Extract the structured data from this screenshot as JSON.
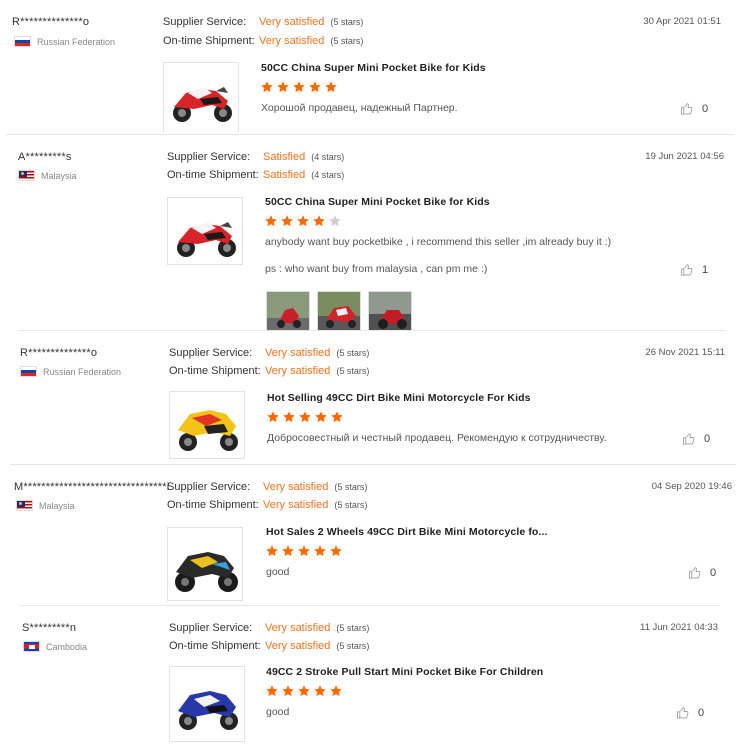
{
  "labels": {
    "supplier_service": "Supplier Service:",
    "ontime_shipment": "On-time Shipment:"
  },
  "colors": {
    "rating_value": "#f2711c",
    "star_filled": "#ff6a00",
    "star_empty": "#d0d0d0",
    "divider": "#e8e8e8"
  },
  "reviews": [
    {
      "buyer": "R**************o",
      "country": "Russian Federation",
      "flag": "russia",
      "supplier_service": {
        "value": "Very satisfied",
        "stars": "(5 stars)"
      },
      "ontime_shipment": {
        "value": "Very satisfied",
        "stars": "(5 stars)"
      },
      "date": "30 Apr 2021 01:51",
      "product_title": "50CC China Super Mini Pocket Bike for Kids",
      "product_image": "red-white-pocket-bike",
      "rating": 5,
      "comment": [
        "Хорошой продавец, надежный Партнер."
      ],
      "helpful_count": "0"
    },
    {
      "buyer": "A*********s",
      "country": "Malaysia",
      "flag": "malaysia",
      "supplier_service": {
        "value": "Satisfied",
        "stars": "(4 stars)"
      },
      "ontime_shipment": {
        "value": "Satisfied",
        "stars": "(4 stars)"
      },
      "date": "19 Jun 2021 04:56",
      "product_title": "50CC China Super Mini Pocket Bike for Kids",
      "product_image": "red-white-pocket-bike",
      "rating": 4,
      "comment": [
        "anybody want buy pocketbike , i recommend this seller ,im already buy it :)",
        "ps : who want buy from malaysia , can pm me :)"
      ],
      "photos": [
        "customer-photo-1",
        "customer-photo-2",
        "customer-photo-3"
      ],
      "helpful_count": "1"
    },
    {
      "buyer": "R**************o",
      "country": "Russian Federation",
      "flag": "russia",
      "supplier_service": {
        "value": "Very satisfied",
        "stars": "(5 stars)"
      },
      "ontime_shipment": {
        "value": "Very satisfied",
        "stars": "(5 stars)"
      },
      "date": "26 Nov 2021 15:11",
      "product_title": "Hot Selling 49CC Dirt Bike Mini Motorcycle For Kids",
      "product_image": "yellow-red-pocket-bike",
      "rating": 5,
      "comment": [
        "Добросовестный и честный продавец. Рекомендую к сотрудничеству."
      ],
      "helpful_count": "0"
    },
    {
      "buyer": "M********************************i",
      "country": "Malaysia",
      "flag": "malaysia",
      "supplier_service": {
        "value": "Very satisfied",
        "stars": "(5 stars)"
      },
      "ontime_shipment": {
        "value": "Very satisfied",
        "stars": "(5 stars)"
      },
      "date": "04 Sep 2020 19:46",
      "product_title": "Hot Sales 2 Wheels 49CC Dirt Bike Mini Motorcycle fo...",
      "product_image": "black-yellow-pocket-bike",
      "rating": 5,
      "comment": [
        "good"
      ],
      "helpful_count": "0"
    },
    {
      "buyer": "S*********n",
      "country": "Cambodia",
      "flag": "cambodia",
      "supplier_service": {
        "value": "Very satisfied",
        "stars": "(5 stars)"
      },
      "ontime_shipment": {
        "value": "Very satisfied",
        "stars": "(5 stars)"
      },
      "date": "11 Jun 2021 04:33",
      "product_title": "49CC 2 Stroke Pull Start Mini Pocket Bike For Children",
      "product_image": "blue-white-pocket-bike",
      "rating": 5,
      "comment": [
        "good"
      ],
      "helpful_count": "0"
    }
  ]
}
